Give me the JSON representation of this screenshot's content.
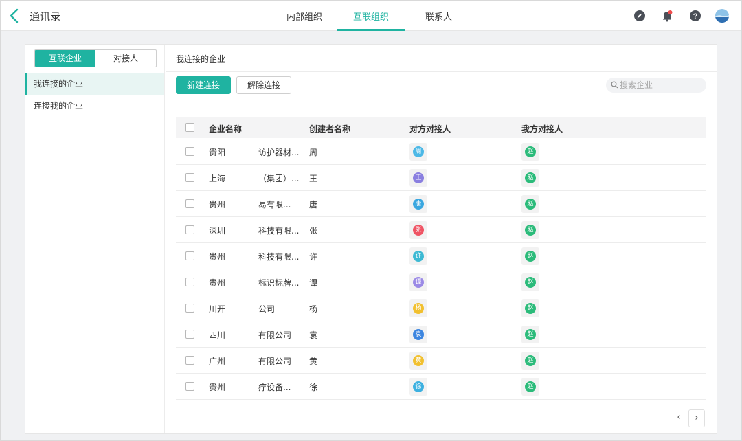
{
  "header": {
    "title": "通讯录",
    "tabs": [
      {
        "label": "内部组织"
      },
      {
        "label": "互联组织"
      },
      {
        "label": "联系人"
      }
    ]
  },
  "sidebar": {
    "segments": [
      {
        "label": "互联企业"
      },
      {
        "label": "对接人"
      }
    ],
    "items": [
      {
        "label": "我连接的企业"
      },
      {
        "label": "连接我的企业"
      }
    ]
  },
  "main": {
    "heading": "我连接的企业",
    "new_button": "新建连接",
    "remove_button": "解除连接",
    "search_placeholder": "搜索企业",
    "columns": [
      "企业名称",
      "创建者名称",
      "对方对接人",
      "我方对接人"
    ],
    "rows": [
      {
        "prefix": "贵阳",
        "company": "访护器材...",
        "creator": "周",
        "their": "周",
        "their_color": "#4bb8e6",
        "mine": "赵",
        "mine_color": "#2bbb7a"
      },
      {
        "prefix": "上海",
        "company": "（集团）...",
        "creator": "王",
        "their": "王",
        "their_color": "#8a7fe0",
        "mine": "赵",
        "mine_color": "#2bbb7a"
      },
      {
        "prefix": "贵州",
        "company": "易有限...",
        "creator": "唐",
        "their": "唐",
        "their_color": "#3aa7e0",
        "mine": "赵",
        "mine_color": "#2bbb7a"
      },
      {
        "prefix": "深圳",
        "company": "科技有限...",
        "creator": "张",
        "their": "张",
        "their_color": "#ef5464",
        "mine": "赵",
        "mine_color": "#2bbb7a"
      },
      {
        "prefix": "贵州",
        "company": "科技有限...",
        "creator": "许",
        "their": "许",
        "their_color": "#3cb9d3",
        "mine": "赵",
        "mine_color": "#2bbb7a"
      },
      {
        "prefix": "贵州",
        "company": "标识标牌...",
        "creator": "谭",
        "their": "谭",
        "their_color": "#9b8ae6",
        "mine": "赵",
        "mine_color": "#2bbb7a"
      },
      {
        "prefix": "川开",
        "company": "公司",
        "creator": "杨",
        "their": "杨",
        "their_color": "#f1c02f",
        "mine": "赵",
        "mine_color": "#2bbb7a"
      },
      {
        "prefix": "四川",
        "company": "有限公司",
        "creator": "袁",
        "their": "袁",
        "their_color": "#3d86e0",
        "mine": "赵",
        "mine_color": "#2bbb7a"
      },
      {
        "prefix": "广州",
        "company": "有限公司",
        "creator": "黄",
        "their": "黄",
        "their_color": "#f1c02f",
        "mine": "赵",
        "mine_color": "#2bbb7a"
      },
      {
        "prefix": "贵州",
        "company": "疗设备...",
        "creator": "徐",
        "their": "徐",
        "their_color": "#3cb0e0",
        "mine": "赵",
        "mine_color": "#2bbb7a"
      }
    ],
    "pager": {
      "prev": "‹",
      "next": "›"
    }
  },
  "colors": {
    "accent": "#1fb3a1"
  }
}
